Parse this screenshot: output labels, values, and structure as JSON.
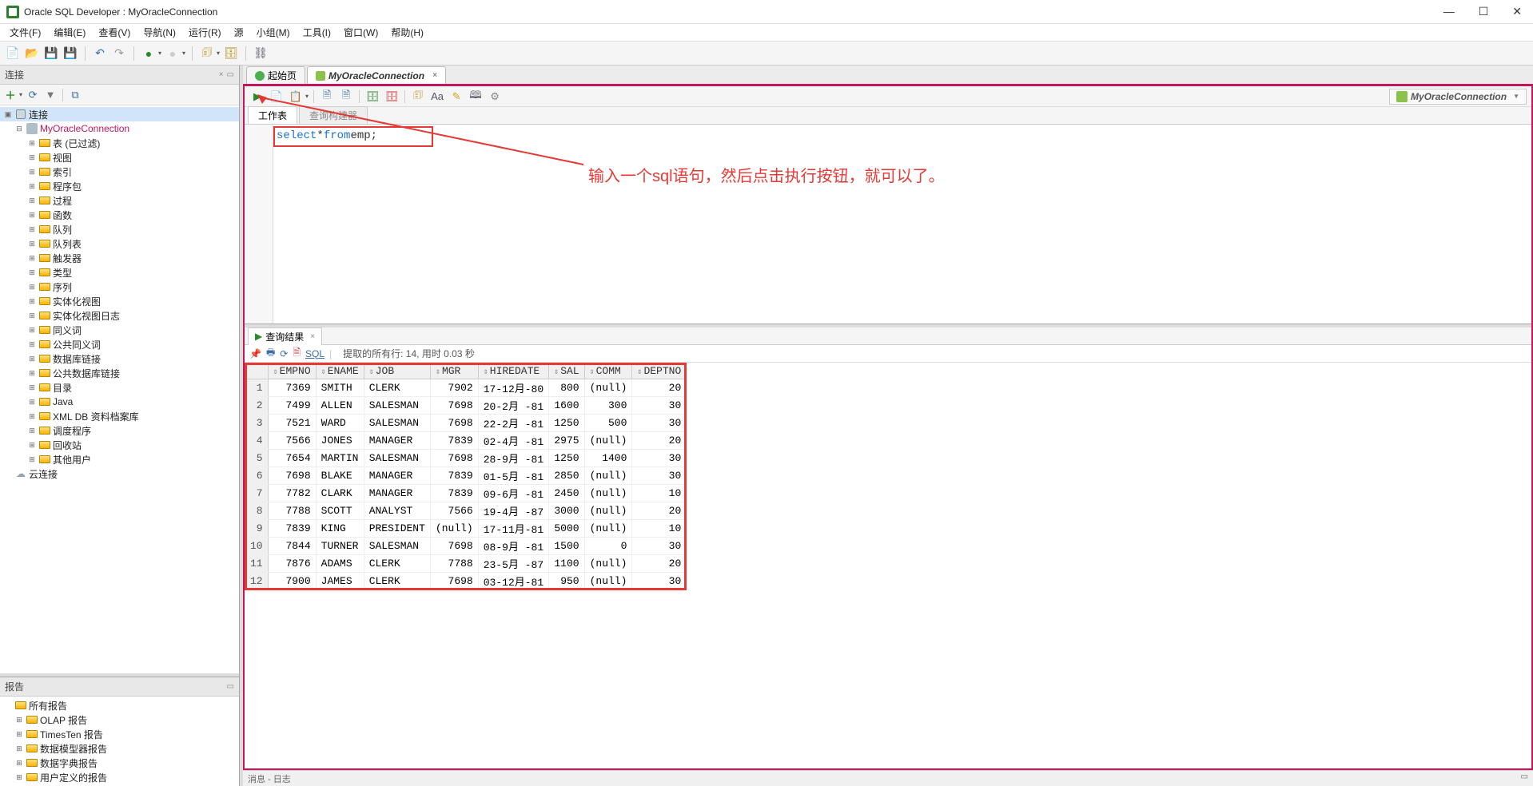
{
  "window": {
    "title": "Oracle SQL Developer : MyOracleConnection"
  },
  "menu": {
    "items": [
      "文件(F)",
      "编辑(E)",
      "查看(V)",
      "导航(N)",
      "运行(R)",
      "源",
      "小组(M)",
      "工具(I)",
      "窗口(W)",
      "帮助(H)"
    ]
  },
  "left": {
    "connections_title": "连接",
    "root_label": "连接",
    "connection_name": "MyOracleConnection",
    "tree_items": [
      "表 (已过滤)",
      "视图",
      "索引",
      "程序包",
      "过程",
      "函数",
      "队列",
      "队列表",
      "触发器",
      "类型",
      "序列",
      "实体化视图",
      "实体化视图日志",
      "同义词",
      "公共同义词",
      "数据库链接",
      "公共数据库链接",
      "目录",
      "Java",
      "XML DB 资料档案库",
      "调度程序",
      "回收站",
      "其他用户"
    ],
    "cloud_label": "云连接",
    "reports_title": "报告",
    "reports_root": "所有报告",
    "reports_items": [
      "OLAP 报告",
      "TimesTen 报告",
      "数据模型器报告",
      "数据字典报告",
      "用户定义的报告"
    ]
  },
  "editor": {
    "tab_home": "起始页",
    "tab_conn": "MyOracleConnection",
    "conn_dropdown": "MyOracleConnection",
    "ws_tab_active": "工作表",
    "ws_tab_inactive": "查询构建器",
    "sql_line": {
      "kw1": "select",
      "star": " * ",
      "kw2": "from",
      "ident": " emp",
      "semi": ";"
    },
    "annotation": "输入一个sql语句，然后点击执行按钮，就可以了。"
  },
  "results": {
    "tab_label": "查询结果",
    "sql_link": "SQL",
    "status": "提取的所有行: 14, 用时 0.03 秒",
    "columns": [
      "EMPNO",
      "ENAME",
      "JOB",
      "MGR",
      "HIREDATE",
      "SAL",
      "COMM",
      "DEPTNO"
    ],
    "rows": [
      [
        "7369",
        "SMITH",
        "CLERK",
        "7902",
        "17-12月-80",
        "800",
        "(null)",
        "20"
      ],
      [
        "7499",
        "ALLEN",
        "SALESMAN",
        "7698",
        "20-2月 -81",
        "1600",
        "300",
        "30"
      ],
      [
        "7521",
        "WARD",
        "SALESMAN",
        "7698",
        "22-2月 -81",
        "1250",
        "500",
        "30"
      ],
      [
        "7566",
        "JONES",
        "MANAGER",
        "7839",
        "02-4月 -81",
        "2975",
        "(null)",
        "20"
      ],
      [
        "7654",
        "MARTIN",
        "SALESMAN",
        "7698",
        "28-9月 -81",
        "1250",
        "1400",
        "30"
      ],
      [
        "7698",
        "BLAKE",
        "MANAGER",
        "7839",
        "01-5月 -81",
        "2850",
        "(null)",
        "30"
      ],
      [
        "7782",
        "CLARK",
        "MANAGER",
        "7839",
        "09-6月 -81",
        "2450",
        "(null)",
        "10"
      ],
      [
        "7788",
        "SCOTT",
        "ANALYST",
        "7566",
        "19-4月 -87",
        "3000",
        "(null)",
        "20"
      ],
      [
        "7839",
        "KING",
        "PRESIDENT",
        "(null)",
        "17-11月-81",
        "5000",
        "(null)",
        "10"
      ],
      [
        "7844",
        "TURNER",
        "SALESMAN",
        "7698",
        "08-9月 -81",
        "1500",
        "0",
        "30"
      ],
      [
        "7876",
        "ADAMS",
        "CLERK",
        "7788",
        "23-5月 -87",
        "1100",
        "(null)",
        "20"
      ],
      [
        "7900",
        "JAMES",
        "CLERK",
        "7698",
        "03-12月-81",
        "950",
        "(null)",
        "30"
      ]
    ]
  },
  "msg_bar": "消息 - 日志"
}
